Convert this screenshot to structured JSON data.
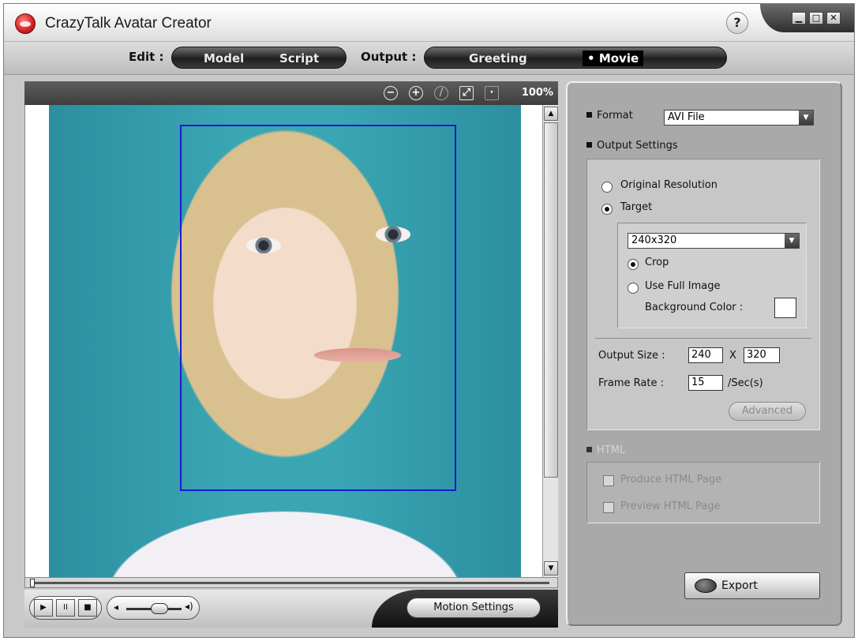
{
  "window": {
    "title": "CrazyTalk Avatar Creator",
    "help_label": "?",
    "minimize_label": "▁",
    "maximize_label": "□",
    "close_label": "✕"
  },
  "nav": {
    "edit_label": "Edit :",
    "model_label": "Model",
    "script_label": "Script",
    "output_label": "Output :",
    "greeting_label": "Greeting",
    "movie_label": "Movie",
    "active": "Movie"
  },
  "viewer": {
    "zoom_level": "100%",
    "tools": [
      "zoom-out-icon",
      "zoom-in-icon",
      "reset-icon",
      "fit-icon",
      "actual-size-icon"
    ]
  },
  "playback": {
    "play_label": "▶",
    "pause_label": "II",
    "stop_label": "■",
    "volume": 0.7,
    "position": 0.0,
    "motion_settings_label": "Motion Settings"
  },
  "panel": {
    "format_label": "Format",
    "format_value": "AVI File",
    "output_settings_label": "Output Settings",
    "original_resolution_label": "Original Resolution",
    "target_label": "Target",
    "resolution_selected": "target",
    "target_value": "240x320",
    "crop_label": "Crop",
    "use_full_image_label": "Use Full Image",
    "image_mode": "crop",
    "background_color_label": "Background Color :",
    "background_color": "#ffffff",
    "output_size_label": "Output Size :",
    "output_width": "240",
    "output_x": "X",
    "output_height": "320",
    "frame_rate_label": "Frame Rate :",
    "frame_rate_value": "15",
    "frame_rate_unit": "/Sec(s)",
    "advanced_label": "Advanced",
    "html_label": "HTML",
    "produce_html_label": "Produce HTML Page",
    "preview_html_label": "Preview HTML Page",
    "export_label": "Export"
  },
  "colors": {
    "crop_box": "#1a1ad0",
    "panel_bg": "#a9a9a9"
  }
}
